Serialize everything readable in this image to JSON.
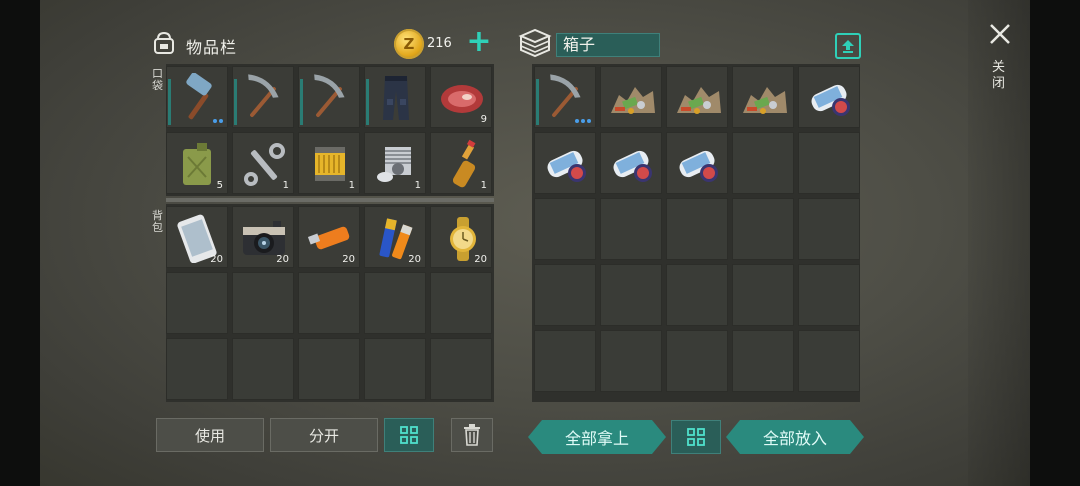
{
  "inventory": {
    "title": "物品栏",
    "coins": "216",
    "pocket_label": "口袋",
    "backpack_label": "背包"
  },
  "box": {
    "name": "箱子"
  },
  "close": {
    "label": "关闭"
  },
  "pocket_items": [
    {
      "icon": "sledgehammer-icon",
      "qty": "",
      "durability": true,
      "dots": 2
    },
    {
      "icon": "pickaxe-icon",
      "qty": "",
      "durability": true,
      "dots": 0
    },
    {
      "icon": "pickaxe-icon",
      "qty": "",
      "durability": true,
      "dots": 0
    },
    {
      "icon": "pants-icon",
      "qty": "",
      "durability": true,
      "dots": 0
    },
    {
      "icon": "raw-meat-icon",
      "qty": "9",
      "durability": false,
      "dots": 0
    },
    {
      "icon": "jerrycan-icon",
      "qty": "5",
      "durability": false,
      "dots": 0
    },
    {
      "icon": "wrench-icon",
      "qty": "1",
      "durability": false,
      "dots": 0
    },
    {
      "icon": "air-filter-icon",
      "qty": "1",
      "durability": false,
      "dots": 0
    },
    {
      "icon": "engine-cylinder-icon",
      "qty": "1",
      "durability": false,
      "dots": 0
    },
    {
      "icon": "bottle-icon",
      "qty": "1",
      "durability": false,
      "dots": 0
    }
  ],
  "backpack_items": [
    {
      "icon": "smartphone-icon",
      "qty": "20"
    },
    {
      "icon": "camera-icon",
      "qty": "20"
    },
    {
      "icon": "usb-drive-icon",
      "qty": "20"
    },
    {
      "icon": "batteries-icon",
      "qty": "20"
    },
    {
      "icon": "gold-watch-icon",
      "qty": "20"
    }
  ],
  "box_items": [
    {
      "icon": "pickaxe-icon",
      "qty": "",
      "durability": true,
      "dots": 3
    },
    {
      "icon": "scrap-pile-icon",
      "qty": ""
    },
    {
      "icon": "scrap-pile-icon",
      "qty": ""
    },
    {
      "icon": "scrap-pile-icon",
      "qty": ""
    },
    {
      "icon": "blueprint-scroll-icon",
      "qty": ""
    },
    {
      "icon": "blueprint-scroll-icon",
      "qty": ""
    },
    {
      "icon": "blueprint-scroll-icon",
      "qty": ""
    },
    {
      "icon": "blueprint-scroll-icon",
      "qty": ""
    }
  ],
  "buttons": {
    "use": "使用",
    "split": "分开",
    "take_all": "全部拿上",
    "put_all": "全部放入"
  }
}
